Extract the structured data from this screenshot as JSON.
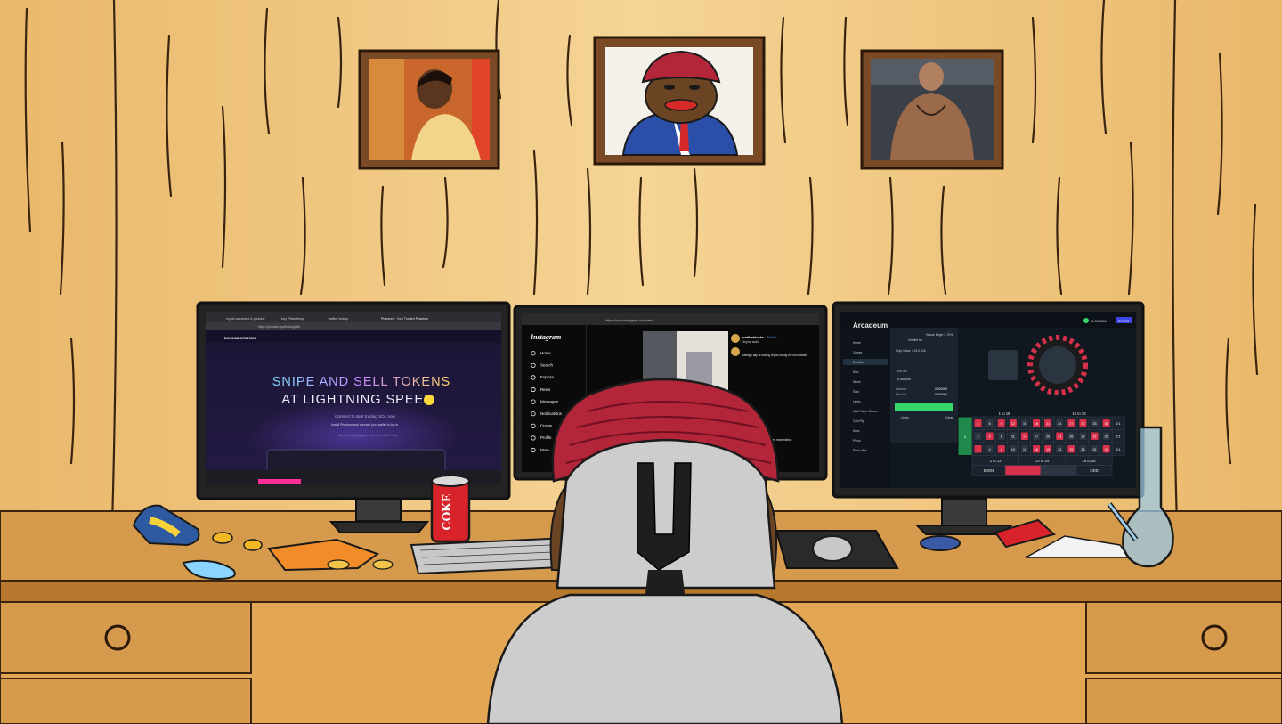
{
  "monitor_left": {
    "tabs": [
      "crypto advanced & youtube",
      "fury Philanthrop",
      "twitter lookup",
      "Phantom - Your Trusted Phantom"
    ],
    "url": "https://phantom.xyz/trading/nfts",
    "doc_label": "DOCUMENTATION",
    "headline_line1": "SNIPE AND SELL TOKENS",
    "headline_line2": "AT LIGHTNING SPEED",
    "subtitle": "Connect to start trading SOL now",
    "install_note": "Install Phantom and connect your wallet to log in.",
    "disclaimer": "By connecting I agree to the Terms & Privacy"
  },
  "monitor_center": {
    "url": "https://www.instagram.com/reel/...",
    "logo": "Instagram",
    "nav": [
      "Home",
      "Search",
      "Explore",
      "Reels",
      "Messages",
      "Notifications",
      "Create",
      "Profile",
      "More"
    ],
    "post_user": "prettiestdonke",
    "post_follow": "Follow",
    "post_audio": "Original audio",
    "post_caption": "Average day of trading crypto during the bull market",
    "more_label": "see more videos"
  },
  "monitor_right": {
    "brand": "Arcadeum",
    "balance": "0.000000",
    "connect_label": "Connect",
    "house_edge": "House Edge: 2.70%",
    "verified": "Verified by",
    "chip_value": "Chip Value: 0.010 SOL",
    "total_bet_label": "Total Bet",
    "total_bet_value": "0.000000",
    "balance_label": "Balance",
    "balance_value": "0.000000",
    "max_bet_label": "Max Bet",
    "max_bet_value": "0.000000",
    "undo_label": "Undo",
    "clear_label": "Clear",
    "sidebar": [
      "Home",
      "Games",
      "Roulette",
      "Dice",
      "Mines",
      "Slide",
      "Limbo",
      "Multi Player Games",
      "Coin Flip",
      "Keno",
      "Plinko",
      "Plinko Max"
    ],
    "roulette_numbers": [
      [
        3,
        6,
        9,
        12,
        15,
        18,
        21,
        24,
        27,
        30,
        33,
        36
      ],
      [
        2,
        5,
        8,
        11,
        14,
        17,
        20,
        23,
        26,
        29,
        32,
        35
      ],
      [
        1,
        4,
        7,
        10,
        13,
        16,
        19,
        22,
        25,
        28,
        31,
        34
      ]
    ],
    "red_numbers": [
      1,
      3,
      5,
      7,
      9,
      12,
      14,
      16,
      18,
      19,
      21,
      23,
      25,
      27,
      30,
      32,
      34,
      36
    ],
    "zero": "0",
    "column_label": "2:1",
    "ranges_top": [
      "1 to 18",
      "19 to 36"
    ],
    "dozens": [
      "1 to 12",
      "13 to 24",
      "25 to 36"
    ],
    "even_label": "EVEN",
    "odd_label": "ODD"
  },
  "desk_items": {
    "can_text": "COKE"
  },
  "colors": {
    "wall": "#efc67e",
    "wall_stripe": "#f6d79b",
    "desk": "#c98a3f",
    "turban": "#b3263a",
    "chair": "#c8c8c8",
    "roulette_red": "#d6304a",
    "neon_green": "#34d66b",
    "instagram_black": "#0a0a0a"
  }
}
